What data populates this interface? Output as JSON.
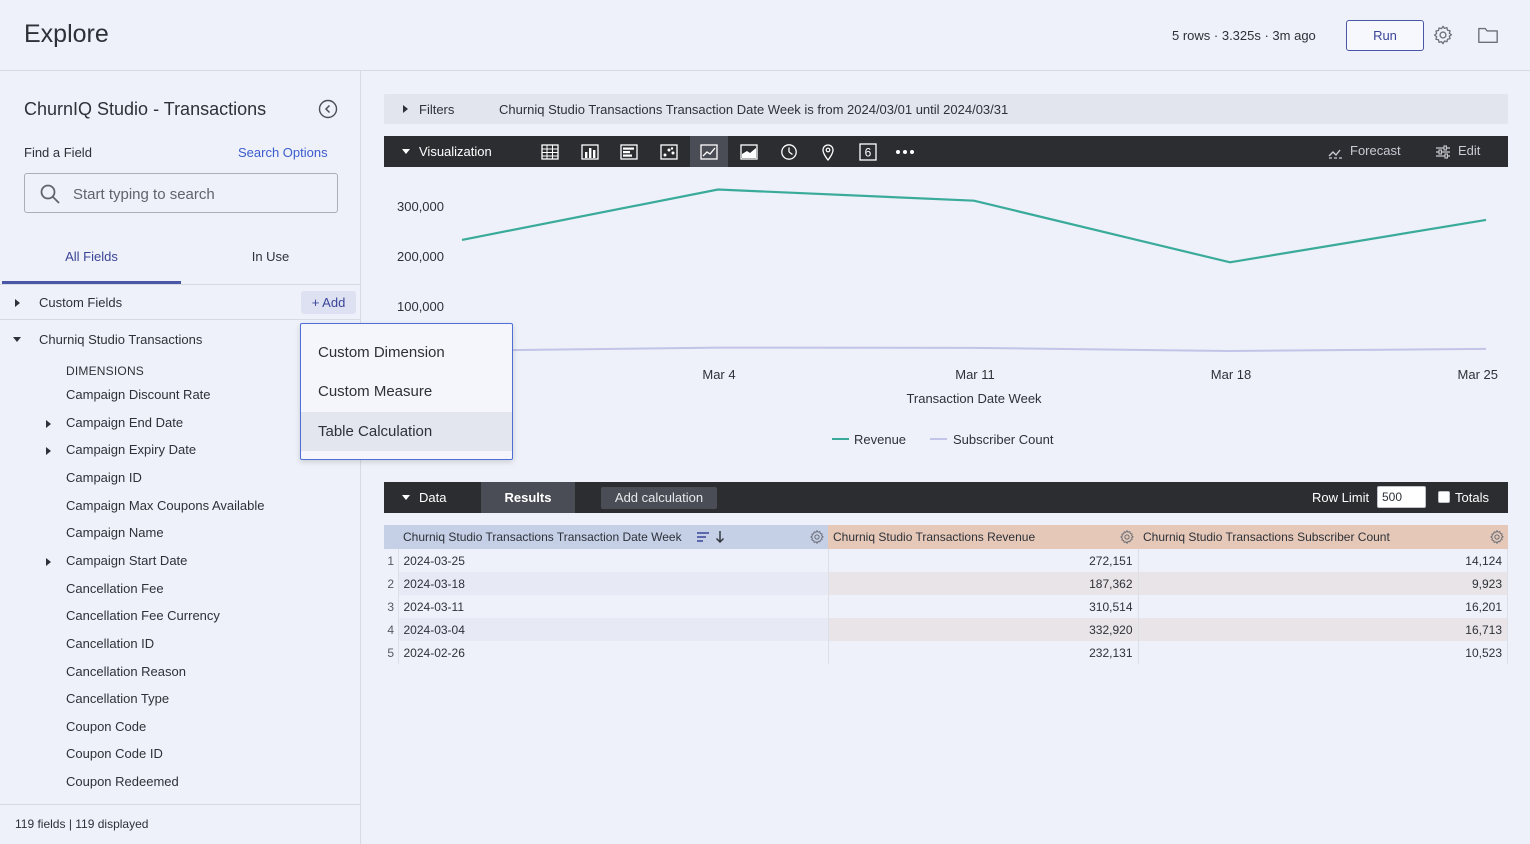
{
  "header": {
    "title": "Explore",
    "run_stats": "5 rows · 3.325s · 3m ago",
    "run_label": "Run"
  },
  "sidebar": {
    "title": "ChurnIQ Studio - Transactions",
    "find_label": "Find a Field",
    "search_options": "Search Options",
    "search_placeholder": "Start typing to search",
    "tabs": [
      {
        "label": "All Fields",
        "active": true
      },
      {
        "label": "In Use",
        "active": false
      }
    ],
    "custom_fields_label": "Custom Fields",
    "add_label": "+ Add",
    "explore_label": "Churniq Studio Transactions",
    "dimensions_header": "DIMENSIONS",
    "fields": [
      {
        "label": "Campaign Discount Rate",
        "expandable": false
      },
      {
        "label": "Campaign End Date",
        "expandable": true
      },
      {
        "label": "Campaign Expiry Date",
        "expandable": true
      },
      {
        "label": "Campaign ID",
        "expandable": false
      },
      {
        "label": "Campaign Max Coupons Available",
        "expandable": false
      },
      {
        "label": "Campaign Name",
        "expandable": false
      },
      {
        "label": "Campaign Start Date",
        "expandable": true
      },
      {
        "label": "Cancellation Fee",
        "expandable": false
      },
      {
        "label": "Cancellation Fee Currency",
        "expandable": false
      },
      {
        "label": "Cancellation ID",
        "expandable": false
      },
      {
        "label": "Cancellation Reason",
        "expandable": false
      },
      {
        "label": "Cancellation Type",
        "expandable": false
      },
      {
        "label": "Coupon Code",
        "expandable": false
      },
      {
        "label": "Coupon Code ID",
        "expandable": false
      },
      {
        "label": "Coupon Redeemed",
        "expandable": false
      }
    ],
    "footer": "119 fields | 119 displayed"
  },
  "add_menu": {
    "items": [
      {
        "label": "Custom Dimension",
        "active": false
      },
      {
        "label": "Custom Measure",
        "active": false
      },
      {
        "label": "Table Calculation",
        "active": true
      }
    ]
  },
  "filters": {
    "label": "Filters",
    "text": "Churniq Studio Transactions Transaction Date Week is from 2024/03/01 until 2024/03/31"
  },
  "visualization": {
    "label": "Visualization",
    "types": [
      "table-icon",
      "column-chart-icon",
      "bar-chart-icon",
      "scatter-icon",
      "line-chart-icon",
      "area-chart-icon",
      "pie-chart-icon",
      "map-pin-icon",
      "single-value-icon",
      "more-icon"
    ],
    "active_type": "line-chart-icon",
    "forecast_label": "Forecast",
    "edit_label": "Edit"
  },
  "chart_data": {
    "type": "line",
    "x": [
      "2024-02-26",
      "2024-03-04",
      "2024-03-11",
      "2024-03-18",
      "2024-03-25"
    ],
    "x_tick_labels": [
      "Mar 4",
      "Mar 11",
      "Mar 18",
      "Mar 25"
    ],
    "xlabel": "Transaction Date Week",
    "ylabel": "",
    "y_ticks": [
      "100,000",
      "200,000",
      "300,000"
    ],
    "series": [
      {
        "name": "Revenue",
        "color": "#3aab9a",
        "values": [
          232131,
          332920,
          310514,
          187362,
          272151
        ]
      },
      {
        "name": "Subscriber Count",
        "color": "#c2c4e8",
        "values": [
          10523,
          16713,
          16201,
          9923,
          14124
        ]
      }
    ],
    "legend_position": "bottom",
    "grid": false
  },
  "data_panel": {
    "label": "Data",
    "results_label": "Results",
    "add_calc_label": "Add calculation",
    "row_limit_label": "Row Limit",
    "row_limit_value": "500",
    "totals_label": "Totals",
    "columns": [
      "Churniq Studio Transactions Transaction Date Week",
      "Churniq Studio Transactions Revenue",
      "Churniq Studio Transactions Subscriber Count"
    ],
    "rows": [
      {
        "n": "1",
        "week": "2024-03-25",
        "revenue": "272,151",
        "subs": "14,124"
      },
      {
        "n": "2",
        "week": "2024-03-18",
        "revenue": "187,362",
        "subs": "9,923"
      },
      {
        "n": "3",
        "week": "2024-03-11",
        "revenue": "310,514",
        "subs": "16,201"
      },
      {
        "n": "4",
        "week": "2024-03-04",
        "revenue": "332,920",
        "subs": "16,713"
      },
      {
        "n": "5",
        "week": "2024-02-26",
        "revenue": "232,131",
        "subs": "10,523"
      }
    ]
  }
}
